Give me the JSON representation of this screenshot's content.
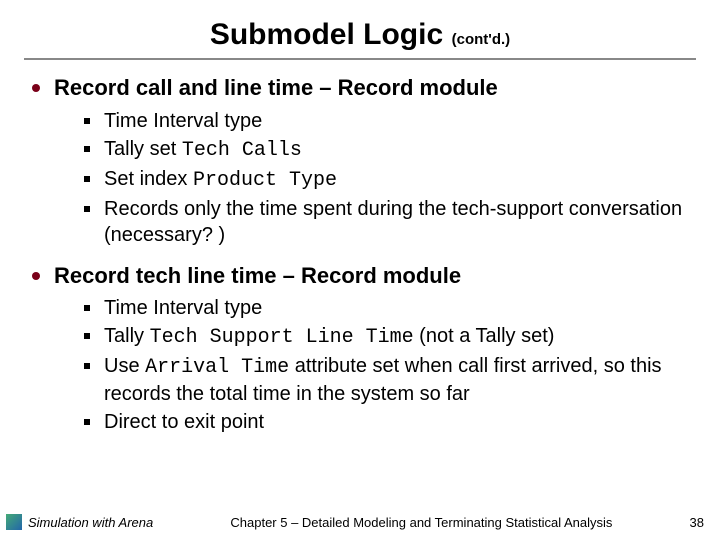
{
  "title": "Submodel Logic",
  "title_suffix": "(cont'd.)",
  "sections": [
    {
      "heading": "Record call and line time – Record module",
      "items": [
        {
          "parts": [
            {
              "t": "Time Interval type"
            }
          ]
        },
        {
          "parts": [
            {
              "t": "Tally set "
            },
            {
              "t": "Tech Calls",
              "mono": true
            }
          ]
        },
        {
          "parts": [
            {
              "t": "Set index "
            },
            {
              "t": "Product Type",
              "mono": true
            }
          ]
        },
        {
          "parts": [
            {
              "t": "Records only the time spent during the tech-support conversation (necessary? )"
            }
          ]
        }
      ]
    },
    {
      "heading": "Record tech line time – Record module",
      "items": [
        {
          "parts": [
            {
              "t": "Time Interval type"
            }
          ]
        },
        {
          "parts": [
            {
              "t": "Tally "
            },
            {
              "t": "Tech Support Line Time",
              "mono": true
            },
            {
              "t": " (not a Tally set)"
            }
          ]
        },
        {
          "parts": [
            {
              "t": "Use "
            },
            {
              "t": "Arrival Time",
              "mono": true
            },
            {
              "t": " attribute set when call first arrived, so this records the total time in the system so far"
            }
          ]
        },
        {
          "parts": [
            {
              "t": "Direct to exit point"
            }
          ]
        }
      ]
    }
  ],
  "footer": {
    "left": "Simulation with Arena",
    "center": "Chapter 5 – Detailed Modeling and Terminating Statistical Analysis",
    "page": "38"
  }
}
